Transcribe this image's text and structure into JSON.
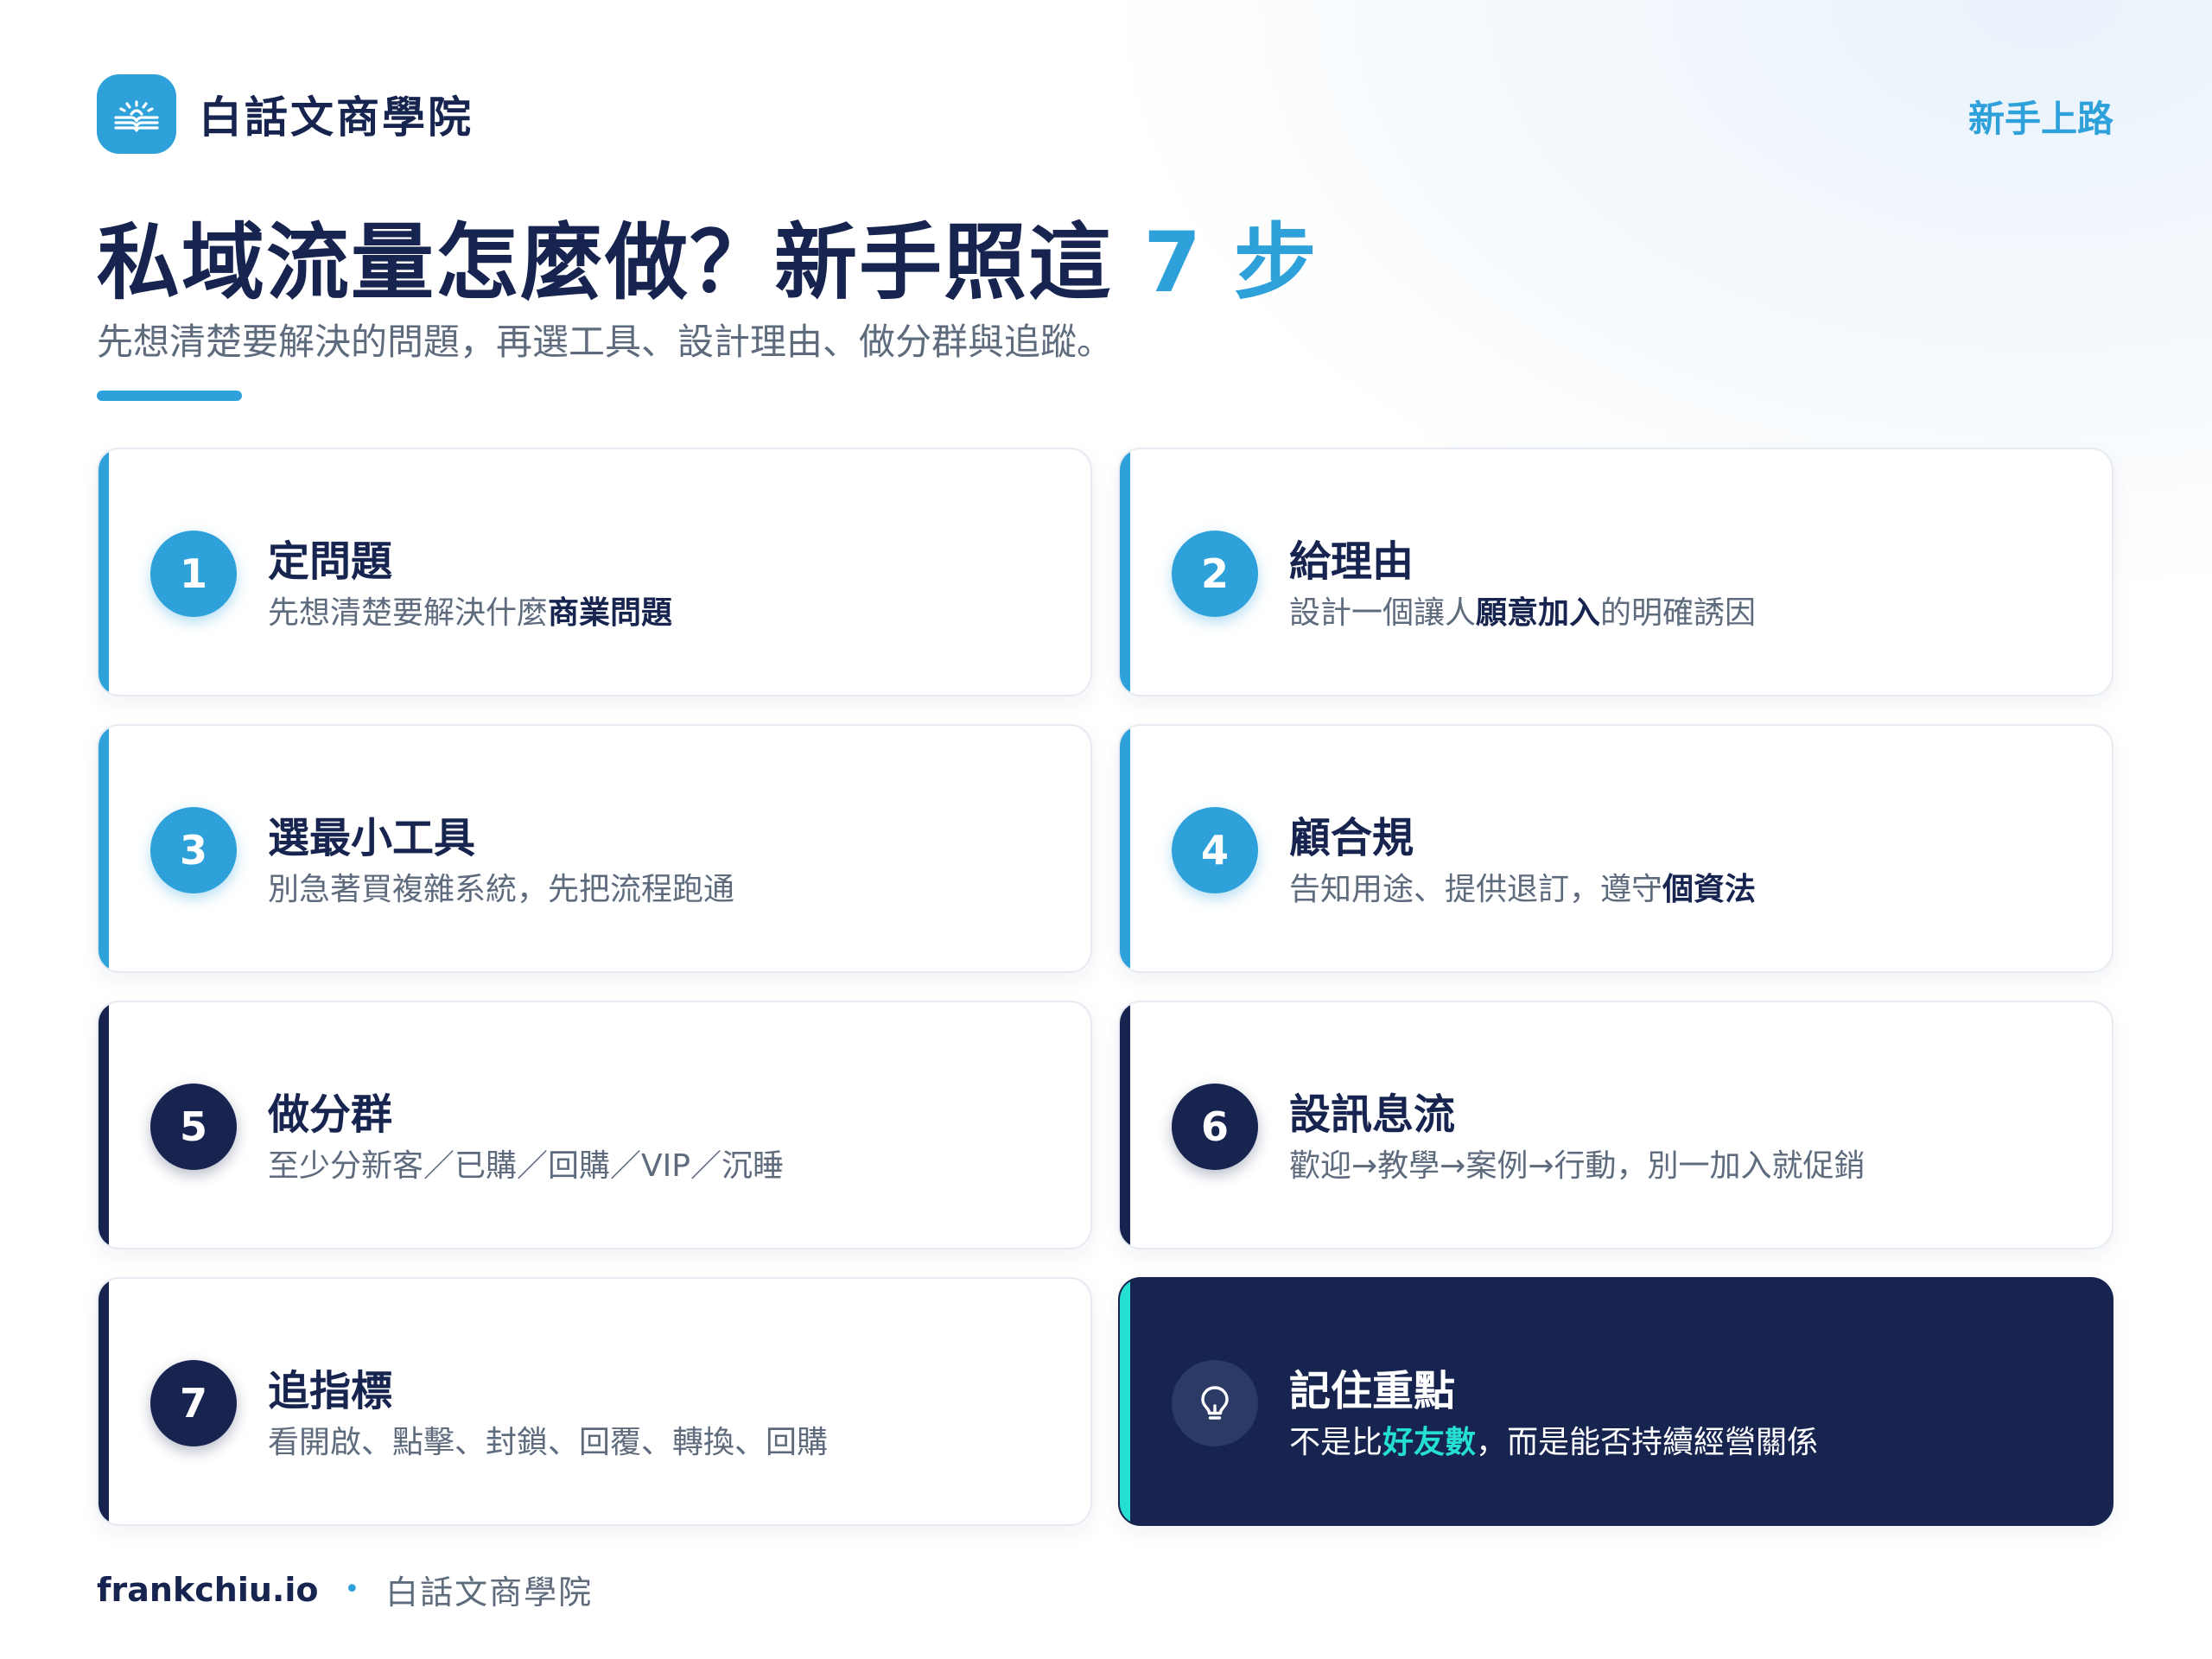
{
  "colors": {
    "primary": "#2ea1db",
    "navy": "#16244f",
    "teal": "#25e0d2",
    "muted": "#5d6b7d"
  },
  "header": {
    "brand_name": "白話文商學院",
    "logo_icon": "open-book-icon",
    "nav_link": "新手上路"
  },
  "hero": {
    "title_main": "私域流量怎麼做？新手照這 ",
    "title_accent": "7 步",
    "subtitle": "先想清楚要解決的問題，再選工具、設計理由、做分群與追蹤。"
  },
  "steps": [
    {
      "num": "1",
      "title": "定問題",
      "desc_pre": "先想清楚要解決什麼",
      "desc_bold": "商業問題",
      "desc_post": ""
    },
    {
      "num": "2",
      "title": "給理由",
      "desc_pre": "設計一個讓人",
      "desc_bold": "願意加入",
      "desc_post": "的明確誘因"
    },
    {
      "num": "3",
      "title": "選最小工具",
      "desc_pre": "別急著買複雜系統，先把流程跑通",
      "desc_bold": "",
      "desc_post": ""
    },
    {
      "num": "4",
      "title": "顧合規",
      "desc_pre": "告知用途、提供退訂，遵守",
      "desc_bold": "個資法",
      "desc_post": ""
    },
    {
      "num": "5",
      "title": "做分群",
      "desc_pre": "至少分新客／已購／回購／VIP／沉睡",
      "desc_bold": "",
      "desc_post": ""
    },
    {
      "num": "6",
      "title": "設訊息流",
      "desc_pre": "歡迎→教學→案例→行動，別一加入就促銷",
      "desc_bold": "",
      "desc_post": ""
    },
    {
      "num": "7",
      "title": "追指標",
      "desc_pre": "看開啟、點擊、封鎖、回覆、轉換、回購",
      "desc_bold": "",
      "desc_post": ""
    }
  ],
  "highlight": {
    "icon": "lightbulb-icon",
    "title": "記住重點",
    "desc_pre": "不是比",
    "desc_bold": "好友數",
    "desc_post": "，而是能否持續經營關係"
  },
  "footer": {
    "site": "frankchiu.io",
    "separator": "•",
    "brand": "白話文商學院"
  }
}
